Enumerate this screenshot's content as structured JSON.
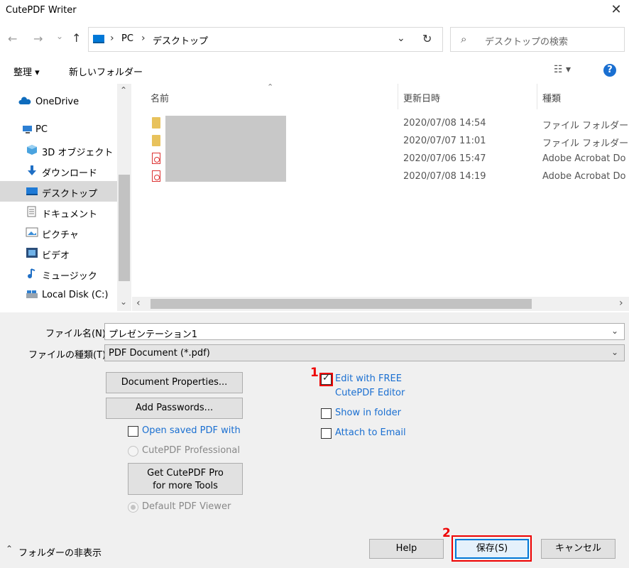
{
  "window": {
    "title": "CutePDF Writer",
    "close_glyph": "✕"
  },
  "nav": {
    "back": "←",
    "forward": "→",
    "recent": "⌄",
    "up": "↑",
    "breadcrumb": [
      "PC",
      "デスクトップ"
    ],
    "breadcrumb_sep": "›",
    "dropdown": "⌄",
    "refresh": "↻",
    "search_placeholder": "デスクトップの検索",
    "search_icon": "⌕"
  },
  "toolbar": {
    "organize": "整理 ▾",
    "new_folder": "新しいフォルダー",
    "view_icon": "☷ ▾",
    "help": "?"
  },
  "sidebar": {
    "items": [
      {
        "label": "OneDrive",
        "icon": "cloud-icon"
      },
      {
        "label": "PC",
        "icon": "pc-icon"
      },
      {
        "label": "3D オブジェクト",
        "icon": "cube-icon"
      },
      {
        "label": "ダウンロード",
        "icon": "download-icon"
      },
      {
        "label": "デスクトップ",
        "icon": "desktop-icon",
        "selected": true
      },
      {
        "label": "ドキュメント",
        "icon": "document-icon"
      },
      {
        "label": "ピクチャ",
        "icon": "picture-icon"
      },
      {
        "label": "ビデオ",
        "icon": "video-icon"
      },
      {
        "label": "ミュージック",
        "icon": "music-icon"
      },
      {
        "label": "Local Disk (C:)",
        "icon": "disk-icon"
      }
    ],
    "scroll_up": "⌃",
    "scroll_down": "⌄"
  },
  "filelist": {
    "columns": {
      "name": "名前",
      "modified": "更新日時",
      "type": "種類"
    },
    "sort_glyph": "⌃",
    "rows": [
      {
        "kind": "folder",
        "date": "2020/07/08 14:54",
        "type": "ファイル フォルダー"
      },
      {
        "kind": "folder",
        "date": "2020/07/07 11:01",
        "type": "ファイル フォルダー"
      },
      {
        "kind": "pdf",
        "date": "2020/07/06 15:47",
        "type": "Adobe Acrobat Do"
      },
      {
        "kind": "pdf",
        "date": "2020/07/08 14:19",
        "type": "Adobe Acrobat Do"
      }
    ],
    "hscroll_left": "‹",
    "hscroll_right": "›"
  },
  "form": {
    "filename_label": "ファイル名(N):",
    "filename_value": "プレゼンテーション1",
    "filetype_label": "ファイルの種類(T):",
    "filetype_value": "PDF Document (*.pdf)",
    "combo_arrow": "⌄"
  },
  "options": {
    "doc_props": "Document Properties...",
    "add_passwords": "Add Passwords...",
    "open_saved_pdf": "Open saved PDF with",
    "cutepdf_professional": "CutePDF Professional",
    "get_pro_line1": "Get CutePDF Pro",
    "get_pro_line2": "for more Tools",
    "default_viewer": "Default PDF Viewer",
    "edit_free_line1": "Edit with FREE",
    "edit_free_line2": "CutePDF Editor",
    "edit_free_checked": true,
    "show_in_folder": "Show in folder",
    "attach_email": "Attach to Email"
  },
  "footer": {
    "hide_folders": "フォルダーの非表示",
    "hide_glyph": "⌃",
    "help": "Help",
    "save": "保存(S)",
    "cancel": "キャンセル"
  },
  "callouts": {
    "one": "1",
    "two": "2"
  }
}
